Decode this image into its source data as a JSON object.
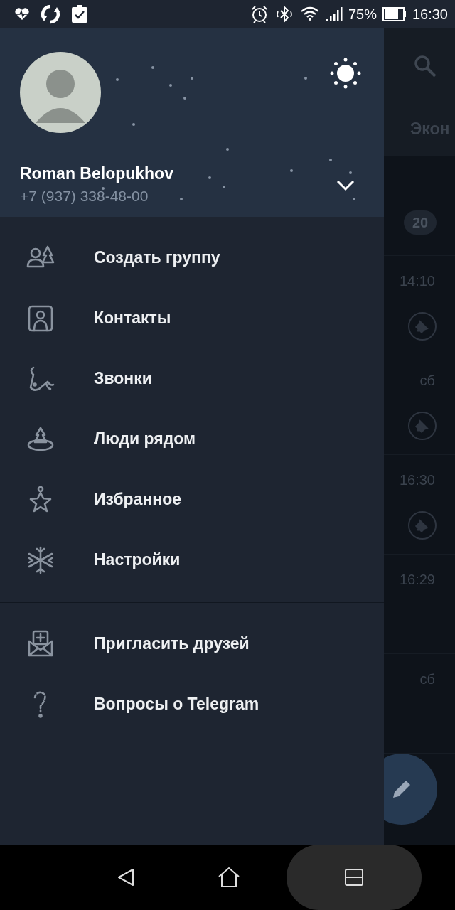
{
  "status_bar": {
    "battery": "75%",
    "time": "16:30"
  },
  "drawer": {
    "profile": {
      "name": "Roman Belopukhov",
      "phone": "+7 (937) 338-48-00"
    },
    "menu_groups": [
      [
        {
          "label": "Создать группу"
        },
        {
          "label": "Контакты"
        },
        {
          "label": "Звонки"
        },
        {
          "label": "Люди рядом"
        },
        {
          "label": "Избранное"
        },
        {
          "label": "Настройки"
        }
      ],
      [
        {
          "label": "Пригласить друзей"
        },
        {
          "label": "Вопросы о Telegram"
        }
      ]
    ]
  },
  "background": {
    "tab": "Экон",
    "chats": [
      {
        "badge": "20",
        "pinned": false
      },
      {
        "time": "14:10",
        "pinned": true
      },
      {
        "time": "сб",
        "pinned": true
      },
      {
        "time": "16:30",
        "pinned": true
      },
      {
        "time": "16:29",
        "pinned": false
      },
      {
        "time": "сб",
        "pinned": false
      }
    ]
  }
}
